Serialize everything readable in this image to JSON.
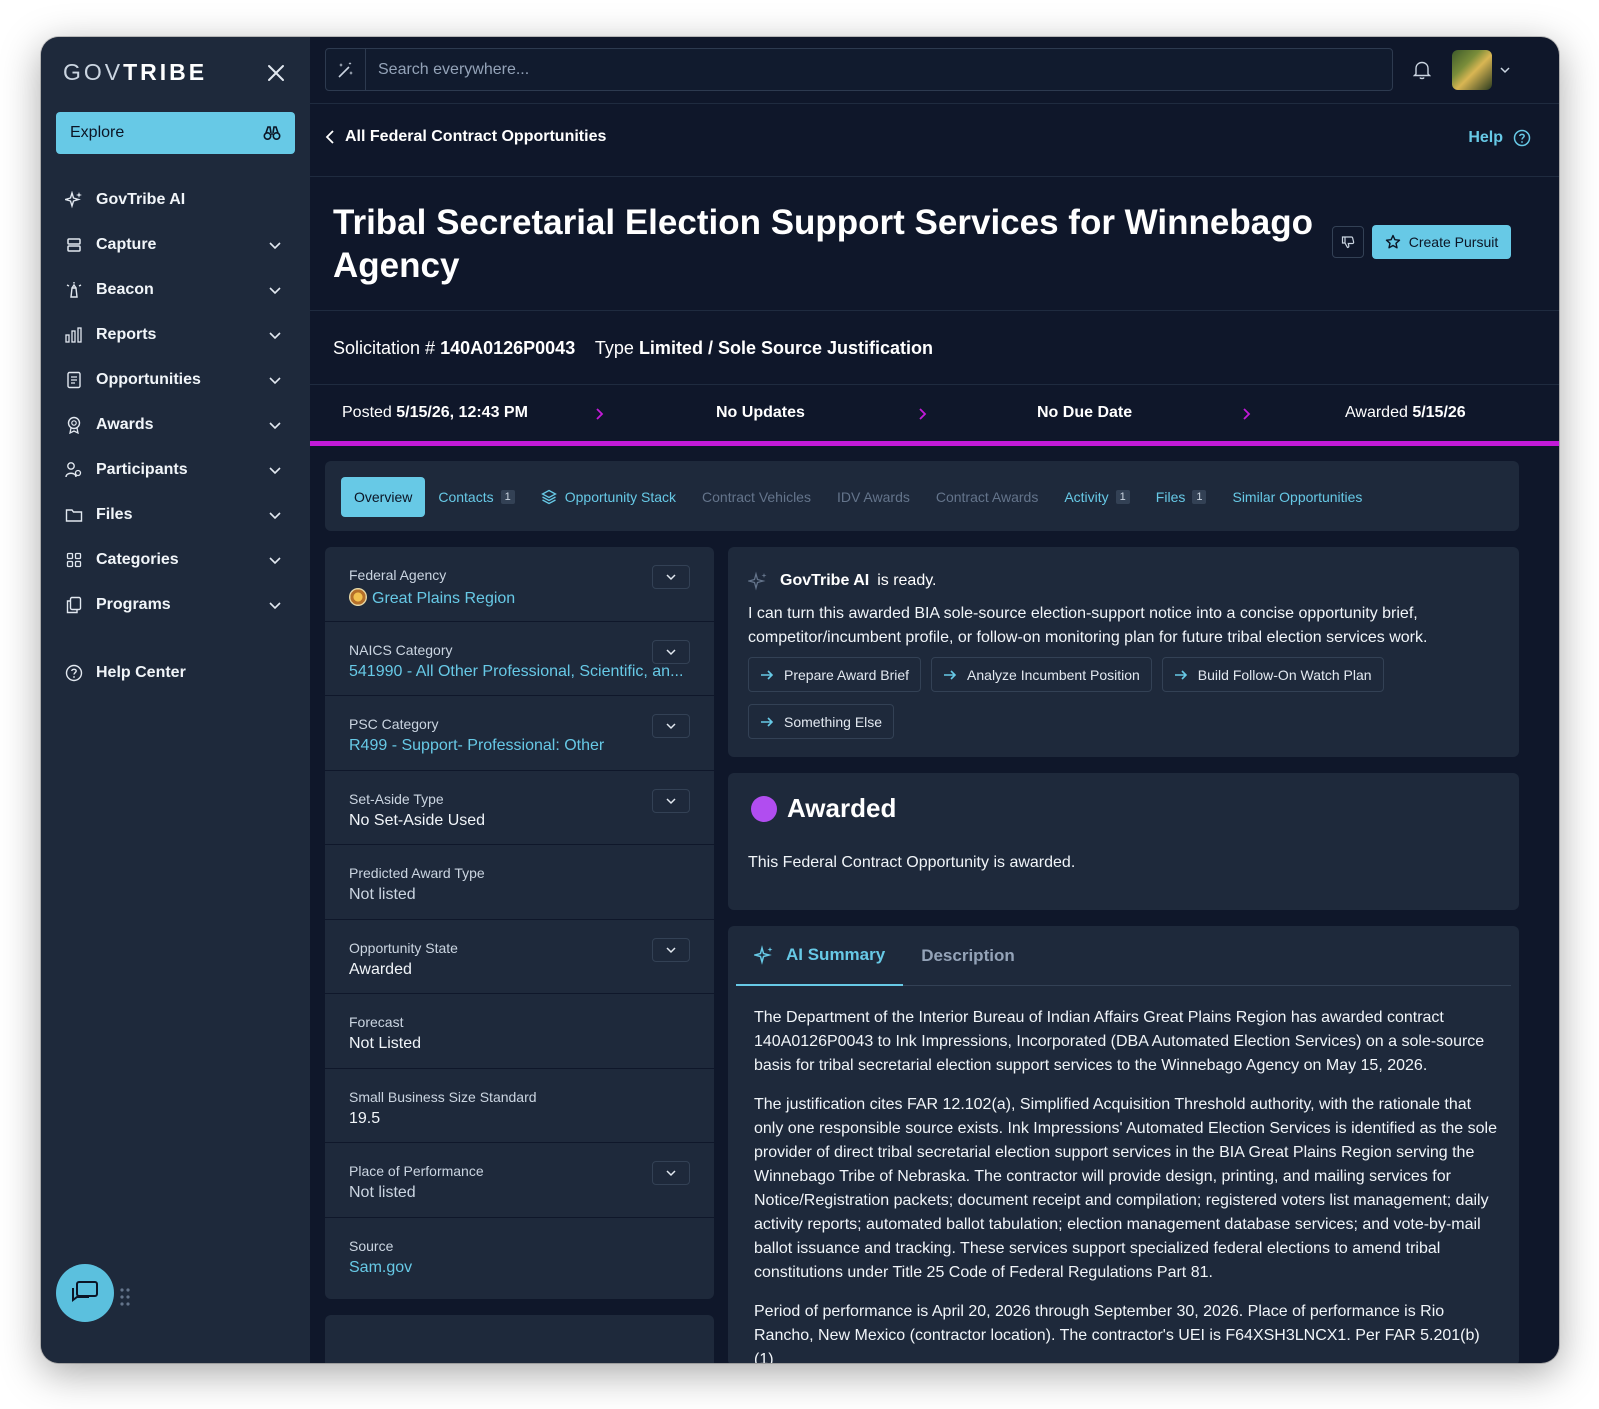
{
  "brand": {
    "logo_light": "GOV",
    "logo_bold": "TRIBE"
  },
  "sidebar": {
    "explore_label": "Explore",
    "items": [
      {
        "label": "GovTribe AI",
        "icon": "sparkles-icon",
        "has_chevron": false
      },
      {
        "label": "Capture",
        "icon": "stack-icon",
        "has_chevron": true
      },
      {
        "label": "Beacon",
        "icon": "beacon-icon",
        "has_chevron": true
      },
      {
        "label": "Reports",
        "icon": "bar-chart-icon",
        "has_chevron": true
      },
      {
        "label": "Opportunities",
        "icon": "document-icon",
        "has_chevron": true
      },
      {
        "label": "Awards",
        "icon": "award-icon",
        "has_chevron": true
      },
      {
        "label": "Participants",
        "icon": "users-icon",
        "has_chevron": true
      },
      {
        "label": "Files",
        "icon": "folder-icon",
        "has_chevron": true
      },
      {
        "label": "Categories",
        "icon": "grid-icon",
        "has_chevron": true
      },
      {
        "label": "Programs",
        "icon": "copy-icon",
        "has_chevron": true
      }
    ],
    "help_center_label": "Help Center"
  },
  "search": {
    "placeholder": "Search everywhere..."
  },
  "breadcrumb": {
    "back_label": "All Federal Contract Opportunities",
    "help_label": "Help"
  },
  "opportunity": {
    "title": "Tribal Secretarial Election Support Services for Winnebago Agency",
    "create_pursuit_label": "Create Pursuit",
    "solicitation_label": "Solicitation #",
    "solicitation_number": "140A0126P0043",
    "type_label": "Type",
    "type_value": "Limited / Sole Source Justification"
  },
  "timeline": {
    "posted_label": "Posted",
    "posted_value": "5/15/26, 12:43 PM",
    "updates": "No Updates",
    "due": "No Due Date",
    "awarded_label": "Awarded",
    "awarded_value": "5/15/26",
    "progress_color": "#c31ad8"
  },
  "tabs": [
    {
      "label": "Overview",
      "count": "",
      "state": "active"
    },
    {
      "label": "Contacts",
      "count": "1",
      "state": "enabled"
    },
    {
      "label": "Opportunity Stack",
      "count": "",
      "state": "enabled"
    },
    {
      "label": "Contract Vehicles",
      "count": "",
      "state": "disabled"
    },
    {
      "label": "IDV Awards",
      "count": "",
      "state": "disabled"
    },
    {
      "label": "Contract Awards",
      "count": "",
      "state": "disabled"
    },
    {
      "label": "Activity",
      "count": "1",
      "state": "enabled"
    },
    {
      "label": "Files",
      "count": "1",
      "state": "enabled"
    },
    {
      "label": "Similar Opportunities",
      "count": "",
      "state": "enabled"
    }
  ],
  "details": [
    {
      "label": "Federal Agency",
      "value": "Great Plains Region",
      "style": "link",
      "expandable": true
    },
    {
      "label": "NAICS Category",
      "value": "541990 - All Other Professional, Scientific, an...",
      "style": "link",
      "expandable": true
    },
    {
      "label": "PSC Category",
      "value": "R499 - Support- Professional: Other",
      "style": "link",
      "expandable": true
    },
    {
      "label": "Set-Aside Type",
      "value": "No Set-Aside Used",
      "style": "plain",
      "expandable": true
    },
    {
      "label": "Predicted Award Type",
      "value": "Not listed",
      "style": "muted",
      "expandable": false
    },
    {
      "label": "Opportunity State",
      "value": "Awarded",
      "style": "plain",
      "expandable": true
    },
    {
      "label": "Forecast",
      "value": "Not Listed",
      "style": "plain",
      "expandable": false
    },
    {
      "label": "Small Business Size Standard",
      "value": "19.5",
      "style": "plain",
      "expandable": false
    },
    {
      "label": "Place of Performance",
      "value": "Not listed",
      "style": "muted",
      "expandable": true
    },
    {
      "label": "Source",
      "value": "Sam.gov",
      "style": "link",
      "expandable": false
    }
  ],
  "ai": {
    "name": "GovTribe AI",
    "status": "is ready.",
    "message": "I can turn this awarded BIA sole-source election-support notice into a concise opportunity brief, competitor/incumbent profile, or follow-on monitoring plan for future tribal election services work.",
    "actions": [
      "Prepare Award Brief",
      "Analyze Incumbent Position",
      "Build Follow-On Watch Plan",
      "Something Else"
    ]
  },
  "status_card": {
    "title": "Awarded",
    "text": "This Federal Contract Opportunity is awarded.",
    "dot_color": "#b14df0"
  },
  "summary": {
    "tab_ai": "AI Summary",
    "tab_description": "Description",
    "paragraphs": [
      "The Department of the Interior Bureau of Indian Affairs Great Plains Region has awarded contract 140A0126P0043 to Ink Impressions, Incorporated (DBA Automated Election Services) on a sole-source basis for tribal secretarial election support services to the Winnebago Agency on May 15, 2026.",
      "The justification cites FAR 12.102(a), Simplified Acquisition Threshold authority, with the rationale that only one responsible source exists. Ink Impressions' Automated Election Services is identified as the sole provider of direct tribal secretarial election support services in the BIA Great Plains Region serving the Winnebago Tribe of Nebraska. The contractor will provide design, printing, and mailing services for Notice/Registration packets; document receipt and compilation; registered voters list management; daily activity reports; automated ballot tabulation; election management database services; and vote-by-mail ballot issuance and tracking. These services support specialized federal elections to amend tribal constitutions under Title 25 Code of Federal Regulations Part 81.",
      "Period of performance is April 20, 2026 through September 30, 2026. Place of performance is Rio Rancho, New Mexico (contractor location). The contractor's UEI is F64XSH3LNCX1. Per FAR 5.201(b)(1)"
    ]
  },
  "colors": {
    "accent": "#67c9e6",
    "background": "#0f172a",
    "panel": "#1e293b"
  }
}
